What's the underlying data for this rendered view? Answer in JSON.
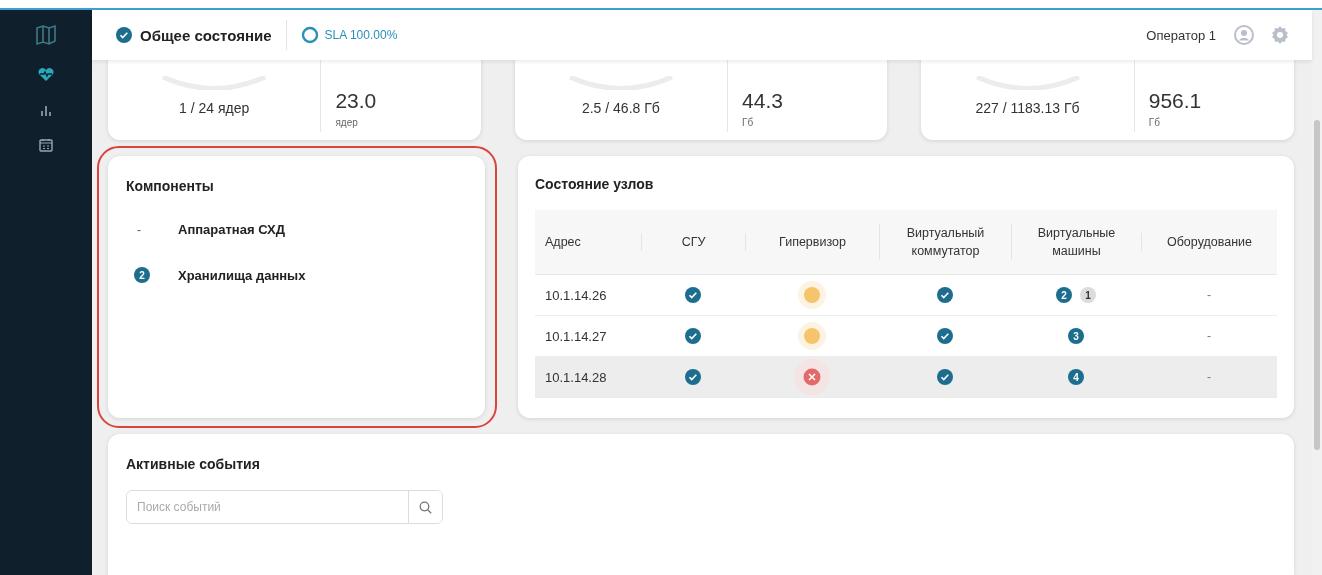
{
  "sidebar": {
    "items": [
      {
        "selected": true
      },
      {
        "selected": false
      },
      {
        "selected": false
      }
    ]
  },
  "header": {
    "status": {
      "label": "Общее состояние",
      "ok": true
    },
    "sla": "SLA 100.00%",
    "user": "Оператор 1"
  },
  "resource_cards": [
    {
      "used": "1 / 24 ядер",
      "free": "23.0",
      "unit": "ядер"
    },
    {
      "used": "2.5 / 46.8 Гб",
      "free": "44.3",
      "unit": "Гб"
    },
    {
      "used": "227 / 1183.13 Гб",
      "free": "956.1",
      "unit": "Гб"
    }
  ],
  "components": {
    "title": "Компоненты",
    "outlined": true,
    "items": [
      {
        "kind": "none",
        "count": "-",
        "label": "Аппаратная СХД"
      },
      {
        "kind": "badge",
        "count": "2",
        "label": "Хранилища данных"
      }
    ]
  },
  "nodes": {
    "title": "Состояние узлов",
    "columns": [
      "Адрес",
      "СГУ",
      "Гипервизор",
      "Виртуальный коммутатор",
      "Виртуальные машины",
      "Оборудование"
    ],
    "rows": [
      {
        "address": "10.1.14.26",
        "hovered": false,
        "sgu": {
          "kind": "ok"
        },
        "hypervisor": {
          "kind": "warning"
        },
        "vswitch": {
          "kind": "ok"
        },
        "vms": [
          {
            "count": "2",
            "color": "#1d6e8e"
          },
          {
            "count": "1",
            "color": "#dcdcdc"
          }
        ],
        "equipment": "-"
      },
      {
        "address": "10.1.14.27",
        "hovered": false,
        "sgu": {
          "kind": "ok"
        },
        "hypervisor": {
          "kind": "warning"
        },
        "vswitch": {
          "kind": "ok"
        },
        "vms": [
          {
            "count": "3",
            "color": "#1d6e8e"
          }
        ],
        "equipment": "-"
      },
      {
        "address": "10.1.14.28",
        "hovered": true,
        "sgu": {
          "kind": "ok"
        },
        "hypervisor": {
          "kind": "error"
        },
        "vswitch": {
          "kind": "ok"
        },
        "vms": [
          {
            "count": "4",
            "color": "#1d6e8e"
          }
        ],
        "equipment": "-"
      }
    ]
  },
  "events": {
    "title": "Активные события",
    "search": {
      "placeholder": "Поиск событий"
    }
  }
}
